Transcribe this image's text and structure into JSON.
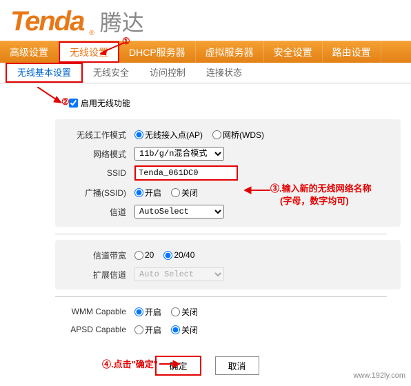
{
  "logo": {
    "brand_en": "Tenda",
    "brand_cn": "腾达"
  },
  "main_nav": {
    "items": [
      "高级设置",
      "无线设置",
      "DHCP服务器",
      "虚拟服务器",
      "安全设置",
      "路由设置"
    ],
    "active_index": 1
  },
  "sub_nav": {
    "items": [
      "无线基本设置",
      "无线安全",
      "访问控制",
      "连接状态"
    ],
    "active_index": 0
  },
  "form": {
    "enable_wireless": "启用无线功能",
    "work_mode": {
      "label": "无线工作模式",
      "ap": "无线接入点(AP)",
      "wds": "网桥(WDS)"
    },
    "network_mode": {
      "label": "网络模式",
      "value": "11b/g/n混合模式"
    },
    "ssid": {
      "label": "SSID",
      "value": "Tenda_061DC0"
    },
    "broadcast": {
      "label": "广播(SSID)",
      "on": "开启",
      "off": "关闭"
    },
    "channel": {
      "label": "信道",
      "value": "AutoSelect"
    },
    "channel_width": {
      "label": "信道带宽",
      "opt1": "20",
      "opt2": "20/40"
    },
    "ext_channel": {
      "label": "扩展信道",
      "value": "Auto Select"
    },
    "wmm": {
      "label": "WMM Capable",
      "on": "开启",
      "off": "关闭"
    },
    "apsd": {
      "label": "APSD Capable",
      "on": "开启",
      "off": "关闭"
    }
  },
  "buttons": {
    "ok": "确定",
    "cancel": "取消"
  },
  "annotations": {
    "n1": "①",
    "n2": "②",
    "n3_line1": "③.输入新的无线网络名称",
    "n3_line2": "(字母，数字均可)",
    "n4": "④.点击\"确定\""
  },
  "watermark": "www.192ly.com"
}
